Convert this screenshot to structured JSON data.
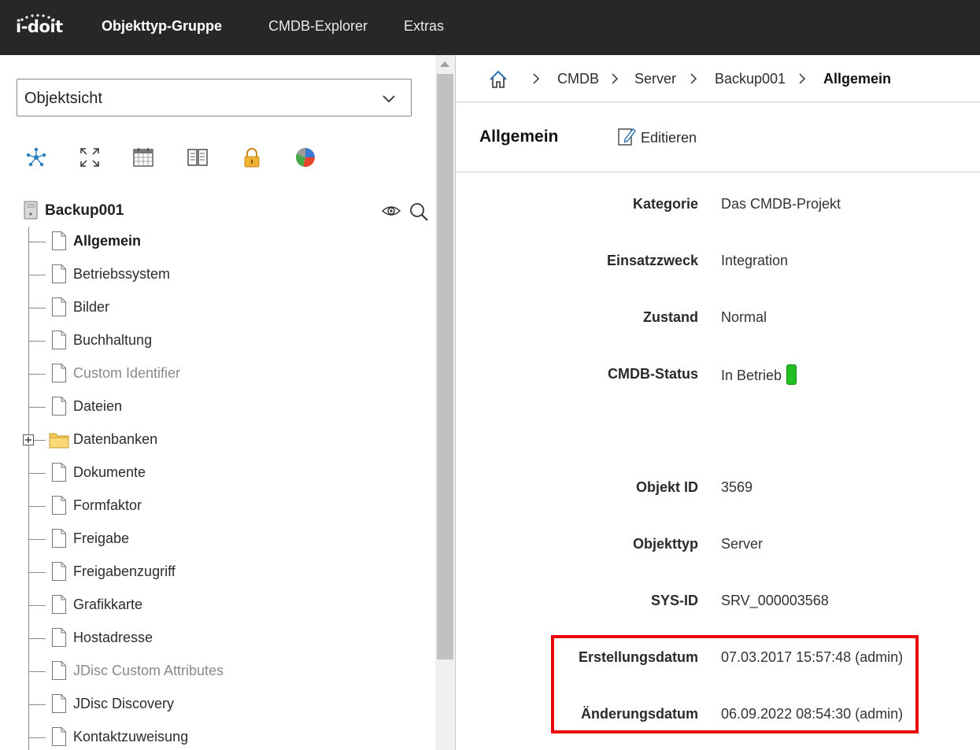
{
  "app": {
    "logo_text": "i-doit",
    "nav": [
      "Objekttyp-Gruppe",
      "CMDB-Explorer",
      "Extras"
    ]
  },
  "sidebar": {
    "view_select": "Objektsicht",
    "toolbar_icons": [
      "network-icon",
      "expand-icon",
      "calendar-icon",
      "book-icon",
      "lock-icon",
      "pie-chart-icon"
    ],
    "root_label": "Backup001",
    "tree": [
      {
        "label": "Allgemein",
        "style": "bold",
        "type": "doc"
      },
      {
        "label": "Betriebssystem",
        "style": "normal",
        "type": "doc"
      },
      {
        "label": "Bilder",
        "style": "normal",
        "type": "doc"
      },
      {
        "label": "Buchhaltung",
        "style": "normal",
        "type": "doc"
      },
      {
        "label": "Custom Identifier",
        "style": "muted",
        "type": "doc"
      },
      {
        "label": "Dateien",
        "style": "normal",
        "type": "doc"
      },
      {
        "label": "Datenbanken",
        "style": "normal",
        "type": "folder"
      },
      {
        "label": "Dokumente",
        "style": "normal",
        "type": "doc"
      },
      {
        "label": "Formfaktor",
        "style": "normal",
        "type": "doc"
      },
      {
        "label": "Freigabe",
        "style": "normal",
        "type": "doc"
      },
      {
        "label": "Freigabenzugriff",
        "style": "normal",
        "type": "doc"
      },
      {
        "label": "Grafikkarte",
        "style": "normal",
        "type": "doc"
      },
      {
        "label": "Hostadresse",
        "style": "normal",
        "type": "doc"
      },
      {
        "label": "JDisc Custom Attributes",
        "style": "muted",
        "type": "doc"
      },
      {
        "label": "JDisc Discovery",
        "style": "normal",
        "type": "doc"
      },
      {
        "label": "Kontaktzuweisung",
        "style": "normal",
        "type": "doc"
      }
    ]
  },
  "breadcrumb": [
    "CMDB",
    "Server",
    "Backup001",
    "Allgemein"
  ],
  "category": {
    "title": "Allgemein",
    "edit_label": "Editieren"
  },
  "fields": [
    {
      "label": "Kategorie",
      "value": "Das CMDB-Projekt"
    },
    {
      "label": "Einsatzzweck",
      "value": "Integration"
    },
    {
      "label": "Zustand",
      "value": "Normal"
    },
    {
      "label": "CMDB-Status",
      "value": "In Betrieb"
    },
    {
      "label": "Objekt ID",
      "value": "3569"
    },
    {
      "label": "Objekttyp",
      "value": "Server"
    },
    {
      "label": "SYS-ID",
      "value": "SRV_000003568"
    },
    {
      "label": "Erstellungsdatum",
      "value": "07.03.2017 15:57:48 (admin)"
    },
    {
      "label": "Änderungsdatum",
      "value": "06.09.2022 08:54:30 (admin)"
    }
  ],
  "colors": {
    "topbar": "#272727",
    "status_green": "#22c022",
    "highlight_red": "#e8000b"
  }
}
